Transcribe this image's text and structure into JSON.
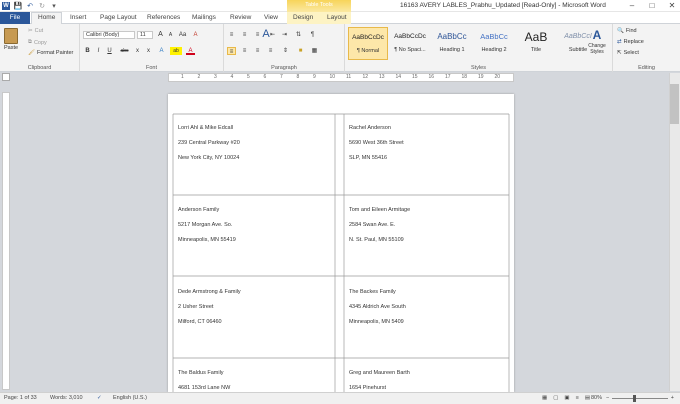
{
  "window": {
    "title": "16163 AVERY LABLES_Prabhu_Updated [Read-Only] - Microsoft Word",
    "contextual_group": "Table Tools",
    "controls": [
      "minimize-icon",
      "maximize-icon",
      "close-icon"
    ]
  },
  "qat": {
    "items": [
      "word-logo-icon",
      "save-icon",
      "undo-icon",
      "redo-icon",
      "customize-icon"
    ]
  },
  "tabs": {
    "file": "File",
    "home": "Home",
    "insert": "Insert",
    "page_layout": "Page Layout",
    "references": "References",
    "mailings": "Mailings",
    "review": "Review",
    "view": "View",
    "design": "Design",
    "layout": "Layout"
  },
  "clipboard": {
    "paste": "Paste",
    "cut": "Cut",
    "copy": "Copy",
    "format_painter": "Format Painter",
    "label": "Clipboard"
  },
  "font": {
    "family": "Calibri (Body)",
    "size": "11",
    "grow": "A",
    "shrink": "A",
    "case": "Aa",
    "clear": "A",
    "bold": "B",
    "italic": "I",
    "underline": "U",
    "strike": "abc",
    "subscript": "x",
    "superscript": "x",
    "effects": "A",
    "highlight": "ab",
    "color": "A",
    "label": "Font"
  },
  "paragraph": {
    "label": "Paragraph",
    "show_marks": "¶"
  },
  "styles": {
    "label": "Styles",
    "items": [
      {
        "preview": "AaBbCcDc",
        "name": "¶ Normal",
        "color": "#222222"
      },
      {
        "preview": "AaBbCcDc",
        "name": "¶ No Spaci...",
        "color": "#222222"
      },
      {
        "preview": "AaBbCc",
        "name": "Heading 1",
        "color": "#2e5597"
      },
      {
        "preview": "AaBbCc",
        "name": "Heading 2",
        "color": "#4472c4"
      },
      {
        "preview": "AaB",
        "name": "Title",
        "color": "#333333"
      },
      {
        "preview": "AaBbCcI",
        "name": "Subtitle",
        "color": "#7f8fa9"
      }
    ],
    "change": "Change Styles"
  },
  "editing": {
    "find": "Find",
    "replace": "Replace",
    "select": "Select",
    "label": "Editing"
  },
  "ruler": {
    "ticks": [
      "1",
      "2",
      "3",
      "4",
      "5",
      "6",
      "7",
      "8",
      "9",
      "10",
      "11",
      "12",
      "13",
      "14",
      "15",
      "16",
      "17",
      "18",
      "19",
      "20"
    ]
  },
  "labels": [
    [
      "Lorri Ahl & Mike Edcall",
      "239 Central Parkway #20",
      "New York City, NY  10024"
    ],
    [
      "Rachel Anderson",
      "5690 West 36th Street",
      "SLP, MN 55416"
    ],
    [
      "Anderson Family",
      "5217 Morgan Ave. So.",
      "Minneapolis, MN 55419"
    ],
    [
      "Tom and Eileen Armitage",
      "2584 Swan Ave. E.",
      "N. St. Paul, MN  55109"
    ],
    [
      "Dede Armstrong & Family",
      "2 Usher Street",
      "Milford, CT  06460"
    ],
    [
      "The Backes Family",
      "4345 Aldrich Ave South",
      "Minneapolis, MN  5409"
    ],
    [
      "The Baldus Family",
      "4681 153rd Lane NW",
      ""
    ],
    [
      "Greg and Maureen Barth",
      "1654 Pinehurst",
      ""
    ]
  ],
  "status": {
    "page": "Page: 1 of 33",
    "words": "Words: 3,010",
    "language": "English (U.S.)",
    "zoom": "80%"
  }
}
